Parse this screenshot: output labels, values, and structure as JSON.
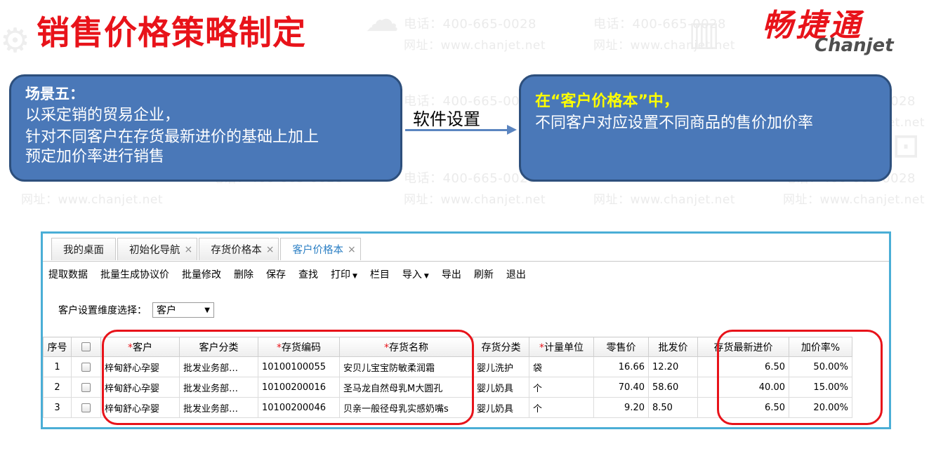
{
  "title": "销售价格策略制定",
  "logo": {
    "cn": "畅捷通",
    "en": "Chanjet"
  },
  "watermark": {
    "phone": "电话：400-665-0028",
    "site": "网址：www.chanjet.net"
  },
  "scenario": {
    "heading": "场景五：",
    "line1": "以采定销的贸易企业，",
    "line2": "针对不同客户在存货最新进价的基础上加上",
    "line3": "预定加价率进行销售"
  },
  "arrow_label": "软件设置",
  "setting": {
    "heading": "在“客户价格本”中，",
    "line1": "不同客户对应设置不同商品的售价加价率"
  },
  "app": {
    "tabs": [
      {
        "label": "我的桌面",
        "closable": ""
      },
      {
        "label": "初始化导航",
        "closable": "×"
      },
      {
        "label": "存货价格本",
        "closable": "×"
      },
      {
        "label": "客户价格本",
        "closable": "×"
      }
    ],
    "toolbar": [
      "提取数据",
      "批量生成协议价",
      "批量修改",
      "删除",
      "保存",
      "查找",
      "打印",
      "栏目",
      "导入",
      "导出",
      "刷新",
      "退出"
    ],
    "dimension": {
      "label": "客户设置维度选择：",
      "value": "客户"
    },
    "columns": [
      "序号",
      "",
      "客户",
      "客户分类",
      "存货编码",
      "存货名称",
      "存货分类",
      "计量单位",
      "零售价",
      "批发价",
      "存货最新进价",
      "加价率%"
    ],
    "rows": [
      {
        "no": "1",
        "customer": "梓甸舒心孕婴",
        "category": "批发业务部…",
        "code": "10100100055",
        "name": "安贝儿宝宝防敏柔润霜",
        "class": "婴儿洗护",
        "unit": "袋",
        "retail": "16.66",
        "wholesale": "12.20",
        "cost": "6.50",
        "markup": "50.00%"
      },
      {
        "no": "2",
        "customer": "梓甸舒心孕婴",
        "category": "批发业务部…",
        "code": "10100200016",
        "name": "圣马龙自然母乳M大圆孔",
        "class": "婴儿奶具",
        "unit": "个",
        "retail": "70.40",
        "wholesale": "58.60",
        "cost": "40.00",
        "markup": "15.00%"
      },
      {
        "no": "3",
        "customer": "梓甸舒心孕婴",
        "category": "批发业务部…",
        "code": "10100200046",
        "name": "贝亲一般径母乳实感奶嘴s",
        "class": "婴儿奶具",
        "unit": "个",
        "retail": "9.20",
        "wholesale": "8.50",
        "cost": "6.50",
        "markup": "20.00%"
      }
    ]
  }
}
